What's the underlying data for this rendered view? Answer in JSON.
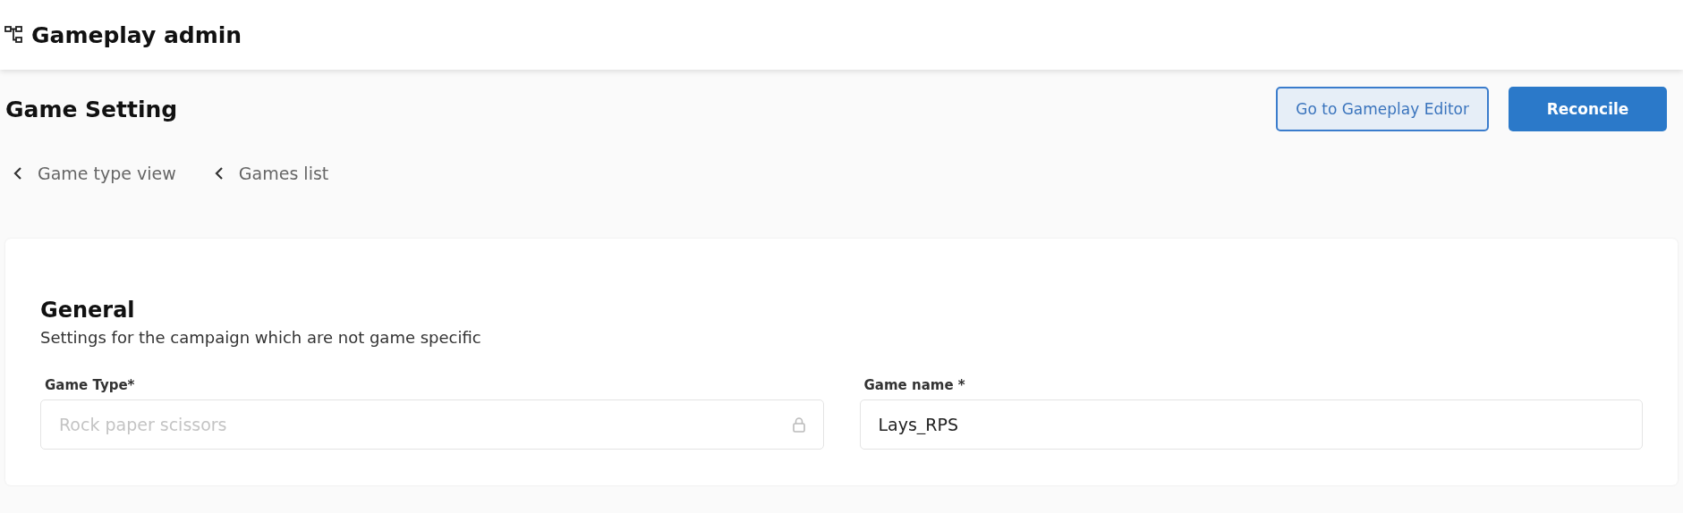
{
  "app": {
    "title": "Gameplay admin"
  },
  "page": {
    "title": "Game Setting"
  },
  "actions": [
    {
      "label": "Go to Gameplay Editor",
      "kind": "secondary"
    },
    {
      "label": "Reconcile",
      "kind": "primary"
    }
  ],
  "breadcrumbs": [
    "Game type view",
    "Games list"
  ],
  "section": {
    "title": "General",
    "description": "Settings for the campaign which are not game specific",
    "fields": [
      {
        "label": "Game Type*",
        "value": "Rock paper scissors",
        "disabled": true
      },
      {
        "label": "Game name *",
        "value": "Lays_RPS",
        "disabled": false
      }
    ]
  }
}
